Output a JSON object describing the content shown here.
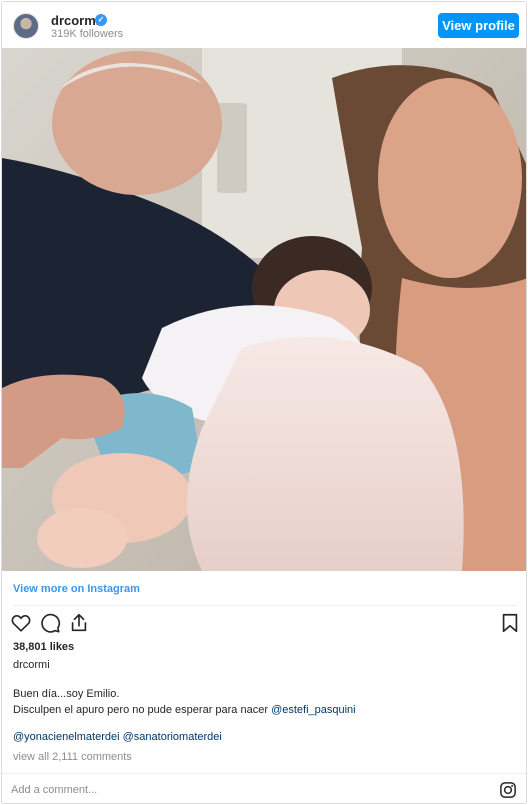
{
  "header": {
    "username": "drcormi",
    "verified_icon": "verified-badge-icon",
    "followers": "319K followers",
    "view_profile_label": "View profile"
  },
  "post": {
    "view_more_label": "View more on Instagram",
    "likes": "38,801 likes",
    "caption_user": "drcormi",
    "caption_line1": "Buen día...soy Emilio.",
    "caption_line2_text": "Disculpen el apuro pero no pude esperar para nacer ",
    "caption_line2_mention": "@estefi_pasquini",
    "tag1": "@yonacienelmaterdei",
    "tag2": "@sanatoriomaterdei",
    "comments_link": "view all 2,111 comments",
    "add_comment_placeholder": "Add a comment..."
  },
  "icons": {
    "like": "heart-icon",
    "comment": "comment-icon",
    "share": "share-icon",
    "save": "bookmark-icon",
    "instagram": "instagram-logo-icon"
  },
  "colors": {
    "accent": "#0095f6",
    "link": "#3897f0",
    "mention": "#00376b",
    "muted": "#8e8e8e"
  }
}
